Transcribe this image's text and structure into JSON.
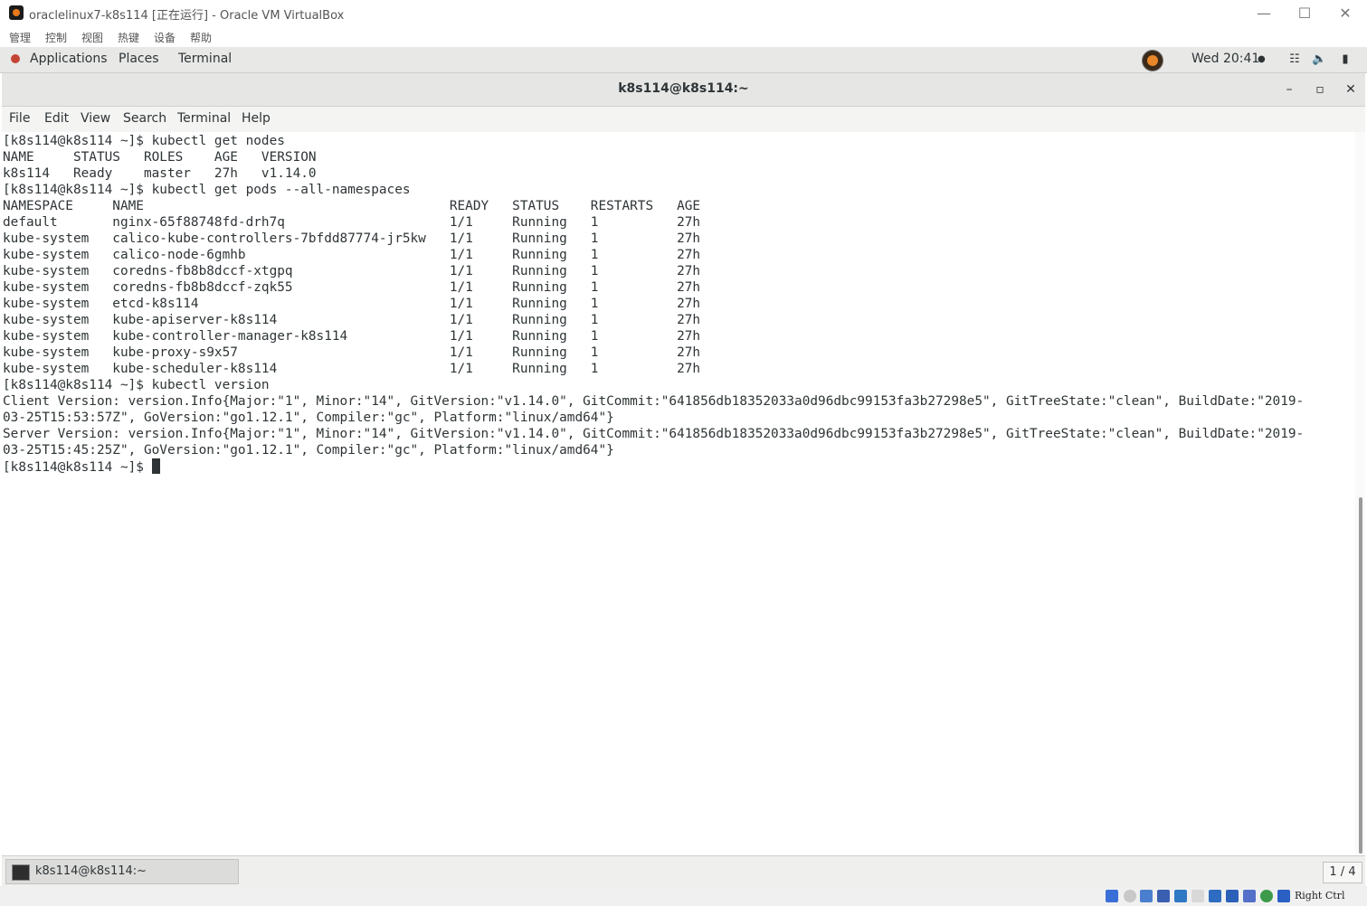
{
  "vbox": {
    "title": "oraclelinux7-k8s114 [正在运行] - Oracle VM VirtualBox",
    "menus": [
      "管理",
      "控制",
      "视图",
      "热键",
      "设备",
      "帮助"
    ],
    "window_controls": {
      "minimize": "—",
      "maximize": "☐",
      "close": "✕"
    },
    "host_key": "Right Ctrl"
  },
  "gnome": {
    "applications": "Applications",
    "places": "Places",
    "terminal": "Terminal",
    "clock": "Wed 20:41",
    "clock_dot": "●"
  },
  "terminal": {
    "title": "k8s114@k8s114:~",
    "controls": {
      "minimize": "–",
      "maximize": "▫",
      "close": "✕"
    },
    "menus": [
      "File",
      "Edit",
      "View",
      "Search",
      "Terminal",
      "Help"
    ],
    "output": "[k8s114@k8s114 ~]$ kubectl get nodes\nNAME     STATUS   ROLES    AGE   VERSION\nk8s114   Ready    master   27h   v1.14.0\n[k8s114@k8s114 ~]$ kubectl get pods --all-namespaces\nNAMESPACE     NAME                                       READY   STATUS    RESTARTS   AGE\ndefault       nginx-65f88748fd-drh7q                     1/1     Running   1          27h\nkube-system   calico-kube-controllers-7bfdd87774-jr5kw   1/1     Running   1          27h\nkube-system   calico-node-6gmhb                          1/1     Running   1          27h\nkube-system   coredns-fb8b8dccf-xtgpq                    1/1     Running   1          27h\nkube-system   coredns-fb8b8dccf-zqk55                    1/1     Running   1          27h\nkube-system   etcd-k8s114                                1/1     Running   1          27h\nkube-system   kube-apiserver-k8s114                      1/1     Running   1          27h\nkube-system   kube-controller-manager-k8s114             1/1     Running   1          27h\nkube-system   kube-proxy-s9x57                           1/1     Running   1          27h\nkube-system   kube-scheduler-k8s114                      1/1     Running   1          27h\n[k8s114@k8s114 ~]$ kubectl version\nClient Version: version.Info{Major:\"1\", Minor:\"14\", GitVersion:\"v1.14.0\", GitCommit:\"641856db18352033a0d96dbc99153fa3b27298e5\", GitTreeState:\"clean\", BuildDate:\"2019-\n03-25T15:53:57Z\", GoVersion:\"go1.12.1\", Compiler:\"gc\", Platform:\"linux/amd64\"}\nServer Version: version.Info{Major:\"1\", Minor:\"14\", GitVersion:\"v1.14.0\", GitCommit:\"641856db18352033a0d96dbc99153fa3b27298e5\", GitTreeState:\"clean\", BuildDate:\"2019-\n03-25T15:45:25Z\", GoVersion:\"go1.12.1\", Compiler:\"gc\", Platform:\"linux/amd64\"}",
    "prompt": "[k8s114@k8s114 ~]$ "
  },
  "taskbar": {
    "task_label": "k8s114@k8s114:~",
    "workspace": "1 / 4"
  },
  "status_icon_colors": [
    "#3a6fd8",
    "#c8c8c8",
    "#4a7fcf",
    "#3a5fb0",
    "#2f78c4",
    "#d8d8d8",
    "#2d6cc0",
    "#2a60b8",
    "#5570c8",
    "#3c9a4a",
    "#2a5fc4"
  ]
}
